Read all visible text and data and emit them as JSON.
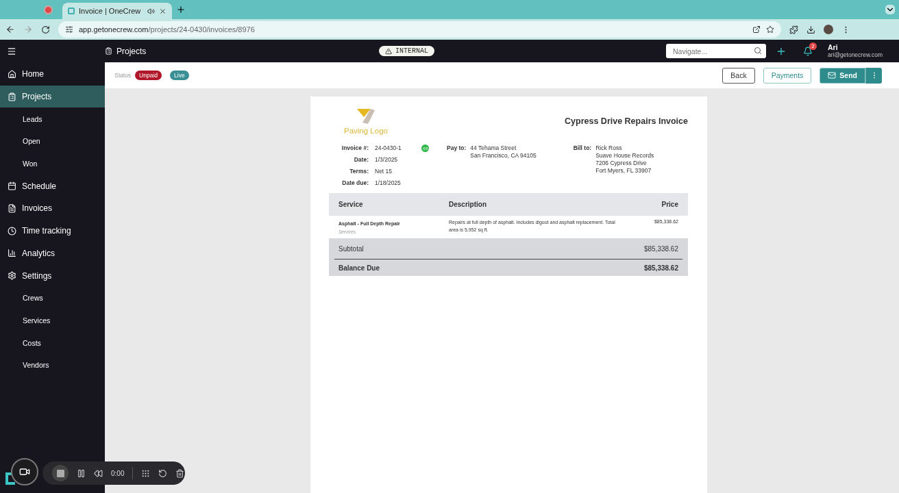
{
  "browser": {
    "tabs": [
      {
        "title": "Invoice | OneCrew",
        "selected": true
      }
    ],
    "url": {
      "domain": "app.getonecrew.com",
      "path": "/projects/24-0430/invoices/8976"
    }
  },
  "header": {
    "title": "Projects",
    "badge": "INTERNAL",
    "search": {
      "placeholder": "Navigate..."
    },
    "notifications": "2",
    "user": {
      "name": "Ari",
      "email": "ari@getonecrew.com"
    }
  },
  "sidebar": {
    "items": [
      {
        "label": "Home",
        "selected": false
      },
      {
        "label": "Projects",
        "selected": true,
        "children": [
          {
            "label": "Leads",
            "selected": false
          },
          {
            "label": "Open",
            "selected": false
          },
          {
            "label": "Won",
            "selected": false
          }
        ]
      },
      {
        "label": "Schedule",
        "selected": false
      },
      {
        "label": "Invoices",
        "selected": false
      },
      {
        "label": "Time tracking",
        "selected": false
      },
      {
        "label": "Analytics",
        "selected": false
      },
      {
        "label": "Settings",
        "selected": false,
        "children": [
          {
            "label": "Crews",
            "selected": false
          },
          {
            "label": "Services",
            "selected": false
          },
          {
            "label": "Costs",
            "selected": false
          },
          {
            "label": "Vendors",
            "selected": false
          }
        ]
      }
    ]
  },
  "status": {
    "label": "Status",
    "tags": [
      {
        "label": "Unpaid",
        "color": "#b0182a"
      },
      {
        "label": "Live",
        "color": "#3a8f95"
      }
    ]
  },
  "actions": [
    {
      "label": "Back",
      "kind": "outline"
    },
    {
      "label": "Payments",
      "kind": "teal-outline"
    },
    {
      "label": "Send",
      "kind": "primary"
    }
  ],
  "invoice": {
    "logo_text": "Paving Logo",
    "title": "Cypress Drive Repairs Invoice",
    "meta": [
      {
        "label": "Invoice #:",
        "value": "24-0430-1"
      },
      {
        "label": "Date:",
        "value": "1/3/2025"
      },
      {
        "label": "Terms:",
        "value": "Net 15"
      },
      {
        "label": "Date due:",
        "value": "1/18/2025"
      }
    ],
    "pay_to": {
      "label": "Pay to:",
      "lines": [
        "44 Tehama Street",
        "San Francisco, CA 94105"
      ]
    },
    "bill_to": {
      "label": "Bill to:",
      "lines": [
        "Rick Ross",
        "Suave House Records",
        "7206 Cypress Drive",
        "Fort Myers, FL 33907"
      ]
    },
    "columns": [
      "Service",
      "Description",
      "Price"
    ],
    "rows": [
      {
        "service": "Asphalt - Full Depth Repair",
        "category": "Services",
        "description": "Repairs at full depth of asphalt. Includes digout and asphalt replacement. Total area is 5,952 sq ft.",
        "price": "$85,338.62"
      }
    ],
    "subtotal": {
      "label": "Subtotal",
      "value": "$85,338.62"
    },
    "balance": {
      "label": "Balance Due",
      "value": "$85,338.62"
    }
  },
  "recorder": {
    "time": "0:00"
  }
}
